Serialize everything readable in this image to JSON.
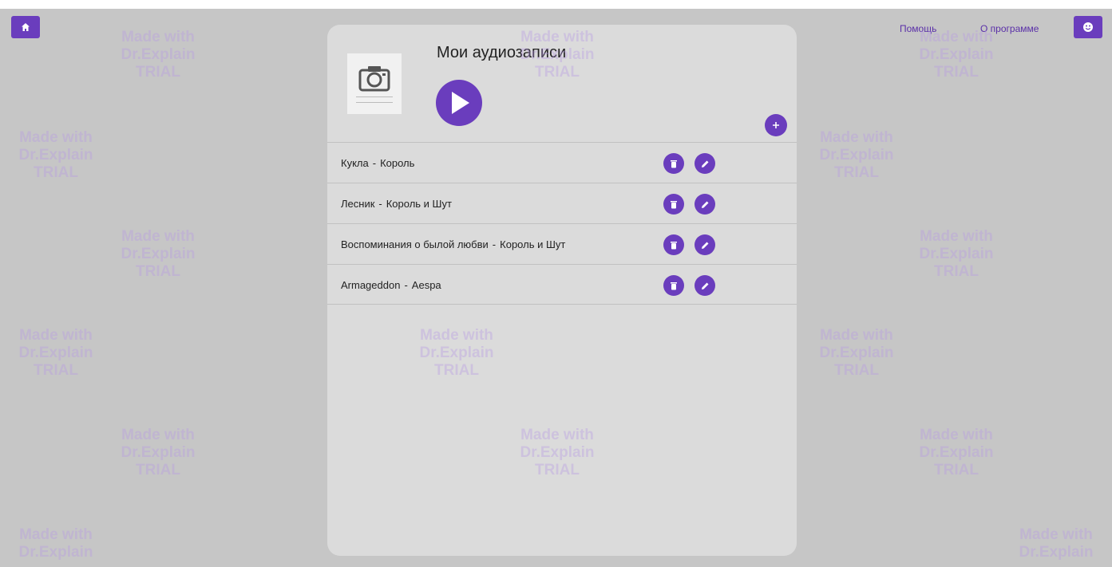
{
  "header": {
    "help_label": "Помощь",
    "about_label": "О программе",
    "home_icon": "home-icon",
    "user_icon": "user-icon"
  },
  "panel": {
    "title": "Мои аудиозаписи",
    "cover_icon": "camera-icon",
    "play_icon": "play-icon",
    "add_icon": "plus-icon"
  },
  "tracks": [
    {
      "title": "Кукла",
      "artist": "Король"
    },
    {
      "title": "Лесник",
      "artist": "Король и Шут"
    },
    {
      "title": "Воспоминания о былой любви",
      "artist": "Король и Шут"
    },
    {
      "title": "Armageddon",
      "artist": "Aespa"
    }
  ],
  "track_separator": "-",
  "watermark": {
    "line1": "Made with",
    "line2": "Dr.Explain",
    "line3": "TRIAL"
  },
  "colors": {
    "accent": "#6a3dbd",
    "overlay": "#c6c6c6",
    "panel": "#dbdbdb"
  }
}
